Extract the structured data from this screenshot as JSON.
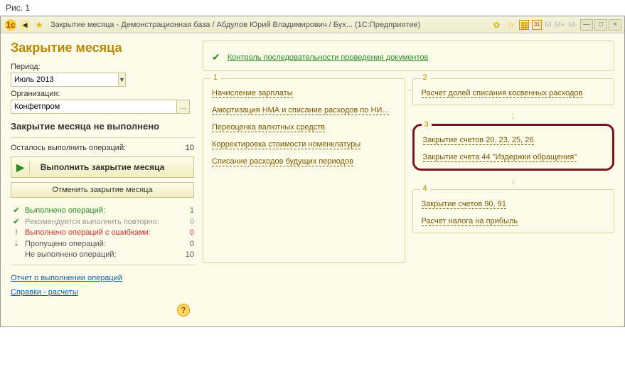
{
  "figure_label": "Рис. 1",
  "window_title": "Закрытие месяца - Демонстрационная база / Абдулов Юрий Владимирович / Бух...   (1С:Предприятие)",
  "page_title": "Закрытие месяца",
  "period": {
    "label": "Период:",
    "value": "Июль 2013"
  },
  "org": {
    "label": "Организация:",
    "value": "Конфетпром"
  },
  "status_title": "Закрытие месяца не выполнено",
  "remaining": {
    "label": "Осталось выполнить операций:",
    "value": "10"
  },
  "btn_main": "Выполнить закрытие месяца",
  "btn_cancel": "Отменить закрытие месяца",
  "stats": {
    "done": {
      "label": "Выполнено операций:",
      "value": "1"
    },
    "retry": {
      "label": "Рекомендуется выполнить повторно:",
      "value": "0"
    },
    "errors": {
      "label": "Выполнено операций с ошибками:",
      "value": "0"
    },
    "skipped": {
      "label": "Пропущено операций:",
      "value": "0"
    },
    "pending": {
      "label": "Не выполнено операций:",
      "value": "10"
    }
  },
  "link_report": "Отчет о выполнении операций",
  "link_refs": "Справки - расчеты",
  "control_link": "Контроль последовательности проведения документов",
  "groups": {
    "g1": {
      "num": "1",
      "items": [
        "Начисление зарплаты",
        "Амортизация НМА и списание расходов по НИ...",
        "Переоценка валютных средств",
        "Корректировка стоимости номенклатуры",
        "Списание расходов будущих периодов"
      ]
    },
    "g2": {
      "num": "2",
      "items": [
        "Расчет долей списания косвенных расходов"
      ]
    },
    "g3": {
      "num": "3",
      "items": [
        "Закрытие счетов 20, 23, 25, 26",
        "Закрытие счета 44 \"Издержки обращения\""
      ]
    },
    "g4": {
      "num": "4",
      "items": [
        "Закрытие счетов 90, 91",
        "Расчет налога на прибыль"
      ]
    }
  }
}
